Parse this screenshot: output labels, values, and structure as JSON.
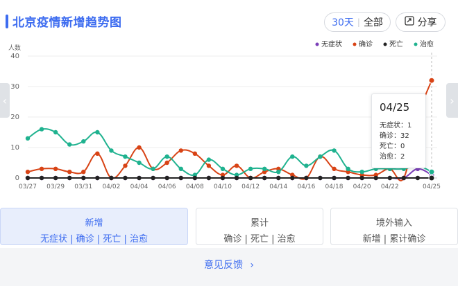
{
  "header": {
    "title": "北京疫情新增趋势图",
    "range_30": "30天",
    "range_sep": "|",
    "range_all": "全部",
    "share_label": "分享"
  },
  "colors": {
    "accent": "#3d6cf0",
    "asymptomatic": "#7b3fb8",
    "confirmed": "#d84315",
    "death": "#222222",
    "cured": "#1fb28f"
  },
  "chart_data": {
    "type": "line",
    "y_unit": "人数",
    "ylim": [
      0,
      40
    ],
    "yticks": [
      0,
      10,
      20,
      30,
      40
    ],
    "x": [
      "03/27",
      "03/28",
      "03/29",
      "03/30",
      "03/31",
      "04/01",
      "04/02",
      "04/03",
      "04/04",
      "04/05",
      "04/06",
      "04/07",
      "04/08",
      "04/09",
      "04/10",
      "04/11",
      "04/12",
      "04/13",
      "04/14",
      "04/15",
      "04/16",
      "04/17",
      "04/18",
      "04/19",
      "04/20",
      "04/21",
      "04/22",
      "04/23",
      "04/24",
      "04/25"
    ],
    "xtick_labels": [
      "03/27",
      "03/29",
      "03/31",
      "04/02",
      "04/04",
      "04/06",
      "04/08",
      "04/10",
      "04/12",
      "04/14",
      "04/16",
      "04/18",
      "04/20",
      "04/22",
      "04/25"
    ],
    "legend_position": "top-right",
    "grid": true,
    "series": [
      {
        "name": "无症状",
        "color": "#7b3fb8",
        "values": [
          0,
          0,
          0,
          0,
          0,
          0,
          0,
          0,
          0,
          0,
          0,
          0,
          0,
          0,
          0,
          0,
          0,
          0,
          0,
          0,
          0,
          0,
          0,
          0,
          0,
          0,
          0,
          0,
          3,
          1
        ]
      },
      {
        "name": "确诊",
        "color": "#d84315",
        "values": [
          2,
          3,
          3,
          2,
          2,
          8,
          0,
          4,
          10,
          3,
          5,
          9,
          8,
          4,
          1,
          4,
          0,
          2,
          3,
          1,
          0,
          7,
          3,
          2,
          1,
          1,
          3,
          0,
          20,
          32
        ]
      },
      {
        "name": "死亡",
        "color": "#222222",
        "values": [
          0,
          0,
          0,
          0,
          0,
          0,
          0,
          0,
          0,
          0,
          0,
          0,
          0,
          0,
          0,
          0,
          0,
          0,
          0,
          0,
          0,
          0,
          0,
          0,
          0,
          0,
          0,
          0,
          0,
          0
        ]
      },
      {
        "name": "治愈",
        "color": "#1fb28f",
        "values": [
          13,
          16,
          15,
          11,
          12,
          15,
          9,
          7,
          5,
          3,
          7,
          3,
          1,
          6,
          3,
          1,
          3,
          3,
          2,
          7,
          4,
          7,
          9,
          3,
          2,
          3,
          3,
          3,
          4,
          2
        ]
      }
    ]
  },
  "tooltip": {
    "date": "04/25",
    "lines": [
      "无症状：1",
      "确诊：32",
      "死亡：0",
      "治愈：2"
    ]
  },
  "tabs": [
    {
      "title": "新增",
      "sub": "无症状 | 确诊 | 死亡 | 治愈"
    },
    {
      "title": "累计",
      "sub": "确诊 | 死亡 | 治愈"
    },
    {
      "title": "境外输入",
      "sub": "新增 | 累计确诊"
    }
  ],
  "footer": {
    "feedback": "意见反馈",
    "chevron": "›"
  }
}
